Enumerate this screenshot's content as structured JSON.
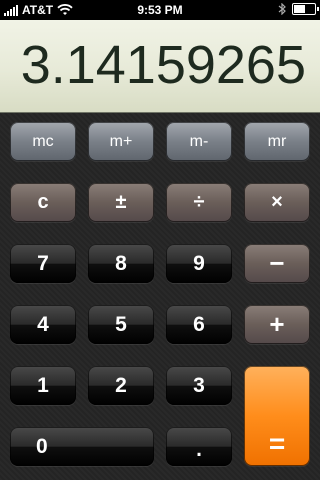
{
  "status_bar": {
    "carrier": "AT&T",
    "time": "9:53 PM",
    "signal_bars": 5,
    "battery_level": 0.55
  },
  "display": {
    "value": "3.14159265"
  },
  "keys": {
    "mc": "mc",
    "mplus": "m+",
    "mminus": "m-",
    "mr": "mr",
    "clear": "c",
    "plusminus": "±",
    "divide": "÷",
    "multiply": "×",
    "seven": "7",
    "eight": "8",
    "nine": "9",
    "minus": "−",
    "four": "4",
    "five": "5",
    "six": "6",
    "plus": "+",
    "one": "1",
    "two": "2",
    "three": "3",
    "zero": "0",
    "decimal": ".",
    "equals": "="
  },
  "colors": {
    "memory_key": "#7a8088",
    "function_key": "#6a5e59",
    "number_key": "#1a1a1a",
    "equals_key": "#ff8d1b",
    "display_bg": "#e7ead8"
  }
}
